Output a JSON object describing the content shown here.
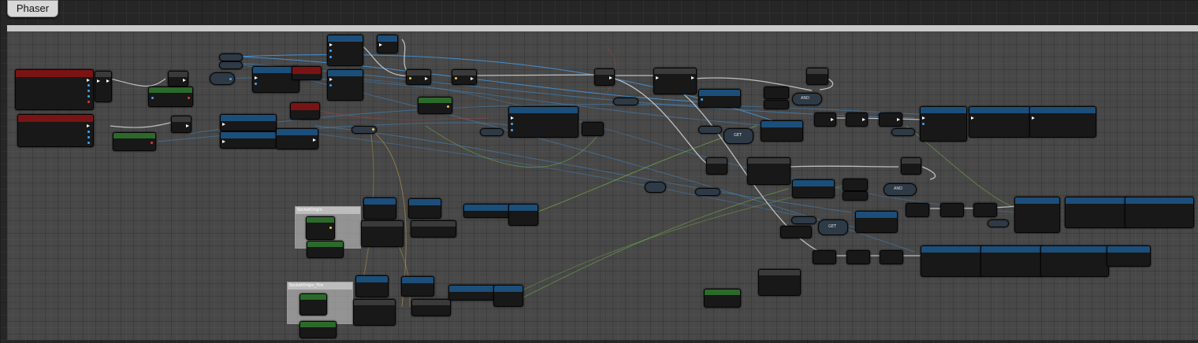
{
  "graph": {
    "tab_label": "Phaser"
  },
  "comments": {
    "group_a": "SocketOrigin",
    "group_b": "SocketOrigin_Fire"
  },
  "node_text": {
    "and_label": "AND",
    "get_label": "GET"
  },
  "colors": {
    "event_header": "#7a1414",
    "function_header": "#1c4e7a",
    "pure_header": "#2b6a2b",
    "exec_wire": "#e6e6e6",
    "object_wire": "#3fa7ff",
    "vector_wire": "#e8b84a",
    "bool_wire": "#8ae24a"
  }
}
